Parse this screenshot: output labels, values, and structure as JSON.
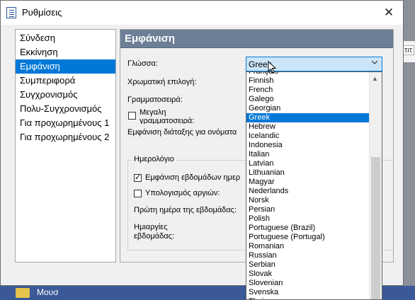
{
  "background": {
    "strip_text": "τιτ",
    "taskbar_text": "Μουσ"
  },
  "window": {
    "title": "Ρυθμίσεις",
    "close_symbol": "✕"
  },
  "nav": {
    "items": [
      {
        "label": "Σύνδεση"
      },
      {
        "label": "Εκκίνηση"
      },
      {
        "label": "Εμφάνιση",
        "selected": true
      },
      {
        "label": "Συμπεριφορά"
      },
      {
        "label": "Συγχρονισμός"
      },
      {
        "label": "Πολυ-Συγχρονισμός"
      },
      {
        "label": "Για προχωρημένους 1"
      },
      {
        "label": "Για προχωρημένους 2"
      }
    ]
  },
  "panel": {
    "header": "Εμφάνιση",
    "language_label": "Γλώσσα:",
    "color_scheme_label": "Χρωματική επιλογή:",
    "font_label": "Γραμματοσειρά:",
    "large_font_label": "Μεγαλη γραμματοσειρά:",
    "name_display_label": "Εμφάνιση διάταξης για ονόματα",
    "calendar_group": "Ημερολόγιο",
    "show_weeks_label": "Εμφάνιση εβδομάδων ημερ",
    "show_weeks_checked": true,
    "compute_holidays_label": "Υπολογισμός αργιών:",
    "compute_holidays_checked": false,
    "first_day_label": "Πρώτη ημέρα της εβδομάδας:",
    "weekdays_label_1": "Ημιαργίες",
    "weekdays_label_2": "εβδομάδας:"
  },
  "language_combo": {
    "value": "Greek",
    "options": [
      "Français",
      "Finnish",
      "French",
      "Galego",
      "Georgian",
      "Greek",
      "Hebrew",
      "Icelandic",
      "Indonesia",
      "Italian",
      "Latvian",
      "Lithuanian",
      "Magyar",
      "Nederlands",
      "Norsk",
      "Persian",
      "Polish",
      "Portuguese (Brazil)",
      "Portuguese (Portugal)",
      "Romanian",
      "Russian",
      "Serbian",
      "Slovak",
      "Slovenian",
      "Svenska",
      "Thai"
    ],
    "selected_index": 5
  },
  "colors": {
    "accent": "#0078d7",
    "panel_header": "#6d7f97",
    "combo_highlight": "#cce4f7"
  }
}
